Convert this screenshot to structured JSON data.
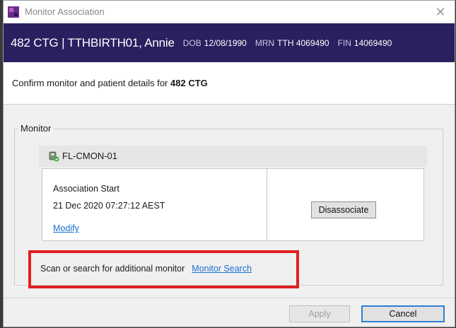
{
  "window": {
    "title": "Monitor Association",
    "close_glyph": "✕",
    "app_icon": "purple-app-icon"
  },
  "patient": {
    "name_line": "482 CTG | TTHBIRTH01, Annie",
    "dob_label": "DOB",
    "dob_value": "12/08/1990",
    "mrn_label": "MRN",
    "mrn_value": "TTH 4069490",
    "fin_label": "FIN",
    "fin_value": "14069490"
  },
  "confirm": {
    "prefix": "Confirm monitor and patient details for",
    "bed": "482 CTG"
  },
  "monitor": {
    "legend": "Monitor",
    "device_icon": "monitor-device-icon",
    "device_name": "FL-CMON-01",
    "association_label": "Association Start",
    "association_value": "21 Dec 2020 07:27:12 AEST",
    "modify_label": "Modify",
    "disassociate_label": "Disassociate"
  },
  "scan": {
    "text": "Scan or search for additional monitor",
    "link_label": "Monitor Search",
    "highlight_color": "#e02020"
  },
  "footer": {
    "apply_label": "Apply",
    "cancel_label": "Cancel"
  },
  "colors": {
    "banner": "#2a2060",
    "link": "#1a6fd0"
  }
}
